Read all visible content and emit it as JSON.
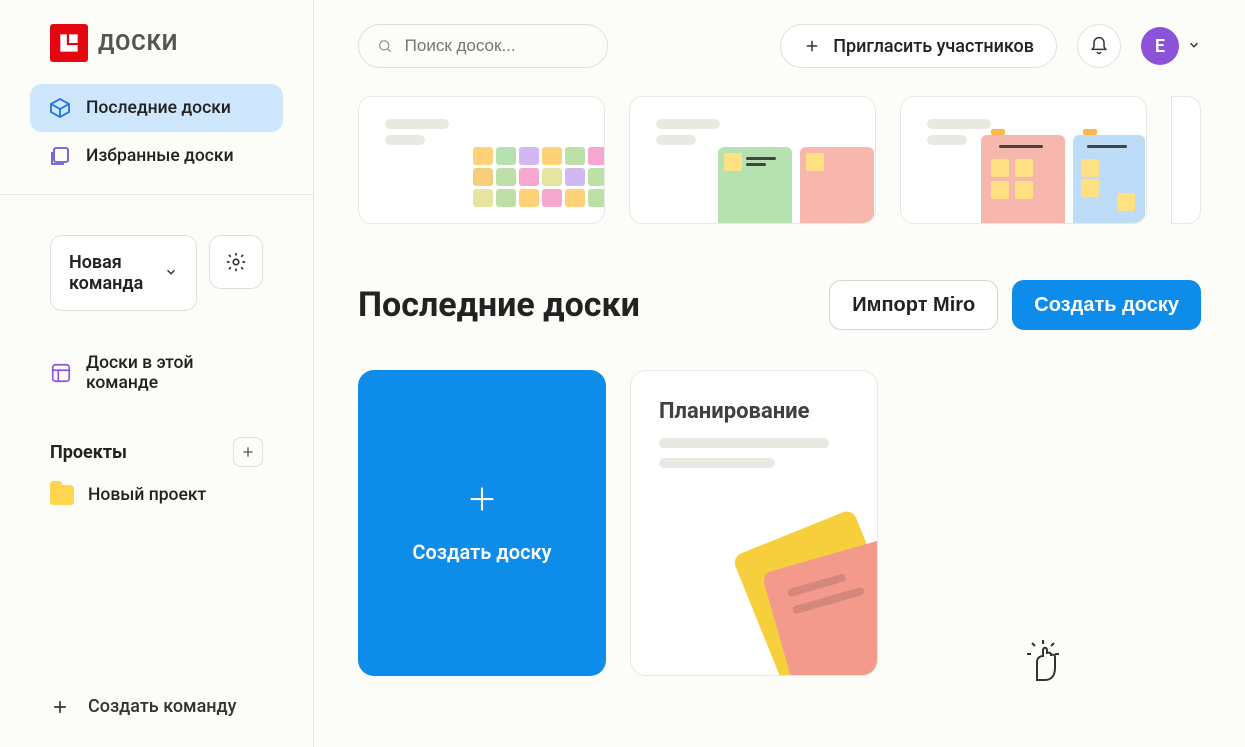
{
  "logo": {
    "word": "ДОСКИ"
  },
  "sidebar": {
    "nav": [
      {
        "label": "Последние доски",
        "active": true
      },
      {
        "label": "Избранные доски",
        "active": false
      }
    ],
    "team_select": "Новая команда",
    "team_boards": "Доски в этой команде",
    "projects_header": "Проекты",
    "projects": [
      {
        "label": "Новый проект"
      }
    ],
    "create_team": "Создать команду"
  },
  "header": {
    "search_placeholder": "Поиск досок...",
    "invite": "Пригласить участников",
    "avatar_letter": "E"
  },
  "headline": "Последние доски",
  "actions": {
    "import": "Импорт Miro",
    "create": "Создать доску"
  },
  "create_card": "Создать доску",
  "boards": [
    {
      "name": "Планирование"
    }
  ],
  "tmpl1_colors": [
    "#ffd27a",
    "#b6e1b0",
    "#d1b8f2",
    "#ffd27a",
    "#bde0a8",
    "#f7a6cf",
    "#f7cf7a",
    "#bde0a8",
    "#f7a6cf",
    "#e5e5a0",
    "#d1b8f2",
    "#bde0a8",
    "#e5e5a0",
    "#bde0a8",
    "#ffd27a",
    "#f7a6cf",
    "#ffd27a",
    "#bde0a8"
  ]
}
